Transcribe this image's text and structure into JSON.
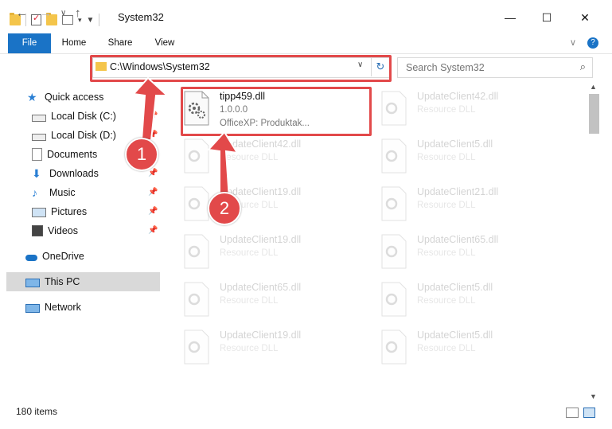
{
  "window": {
    "title": "System32",
    "minimize_glyph": "—",
    "maximize_glyph": "☐",
    "close_glyph": "✕"
  },
  "ribbon": {
    "tabs": [
      "File",
      "Home",
      "Share",
      "View"
    ],
    "expand_glyph": "∨",
    "help_glyph": "?"
  },
  "nav": {
    "back": "←",
    "forward": "→",
    "recent": "∨",
    "up": "↑"
  },
  "address": {
    "path": "C:\\Windows\\System32",
    "chevron": "∨",
    "refresh": "↻"
  },
  "search": {
    "placeholder": "Search System32",
    "icon": "search-icon"
  },
  "sidebar": {
    "quick_access": "Quick access",
    "items": [
      {
        "label": "Local Disk (C:)",
        "icon": "drive-icon",
        "pinned": true
      },
      {
        "label": "Local Disk (D:)",
        "icon": "drive-icon",
        "pinned": true
      },
      {
        "label": "Documents",
        "icon": "documents-icon",
        "pinned": true
      },
      {
        "label": "Downloads",
        "icon": "downloads-icon",
        "pinned": true
      },
      {
        "label": "Music",
        "icon": "music-icon",
        "pinned": true
      },
      {
        "label": "Pictures",
        "icon": "pictures-icon",
        "pinned": true
      },
      {
        "label": "Videos",
        "icon": "videos-icon",
        "pinned": true
      }
    ],
    "onedrive": "OneDrive",
    "thispc": "This PC",
    "network": "Network"
  },
  "files": {
    "highlight": {
      "name": "tipp459.dll",
      "version": "1.0.0.0",
      "description": "OfficeXP: Produktak..."
    },
    "col1": [
      {
        "name": "UpdateClient42.dll",
        "type": "Resource DLL"
      },
      {
        "name": "UpdateClient19.dll",
        "type": "Resource DLL"
      },
      {
        "name": "UpdateClient19.dll",
        "type": "Resource DLL"
      },
      {
        "name": "UpdateClient65.dll",
        "type": "Resource DLL"
      },
      {
        "name": "UpdateClient19.dll",
        "type": "Resource DLL"
      }
    ],
    "col2": [
      {
        "name": "UpdateClient42.dll",
        "type": "Resource DLL"
      },
      {
        "name": "UpdateClient5.dll",
        "type": "Resource DLL"
      },
      {
        "name": "UpdateClient21.dll",
        "type": "Resource DLL"
      },
      {
        "name": "UpdateClient65.dll",
        "type": "Resource DLL"
      },
      {
        "name": "UpdateClient5.dll",
        "type": "Resource DLL"
      },
      {
        "name": "UpdateClient5.dll",
        "type": "Resource DLL"
      }
    ]
  },
  "callouts": [
    "1",
    "2"
  ],
  "status": {
    "item_count": "180 items"
  },
  "colors": {
    "accent": "#1a73c6",
    "highlight_red": "#e2494a"
  }
}
